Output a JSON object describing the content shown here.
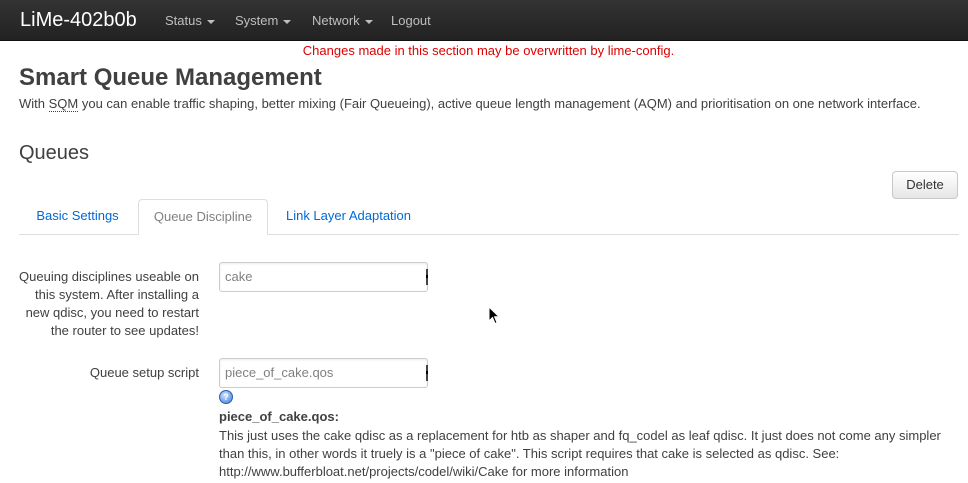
{
  "navbar": {
    "brand": "LiMe-402b0b",
    "items": [
      {
        "label": "Status",
        "dropdown": true
      },
      {
        "label": "System",
        "dropdown": true
      },
      {
        "label": "Network",
        "dropdown": true
      },
      {
        "label": "Logout",
        "dropdown": false
      }
    ]
  },
  "warning": "Changes made in this section may be overwritten by lime-config.",
  "page": {
    "title": "Smart Queue Management",
    "desc_prefix": "With ",
    "desc_abbr": "SQM",
    "desc_suffix": " you can enable traffic shaping, better mixing (Fair Queueing), active queue length management (AQM) and prioritisation on one network interface."
  },
  "section": {
    "title": "Queues",
    "delete_label": "Delete",
    "tabs": [
      {
        "label": "Basic Settings",
        "active": false
      },
      {
        "label": "Queue Discipline",
        "active": true
      },
      {
        "label": "Link Layer Adaptation",
        "active": false
      }
    ]
  },
  "fields": {
    "qdisc": {
      "label": "Queuing disciplines useable on this system. After installing a new qdisc, you need to restart the router to see updates!",
      "value": "cake"
    },
    "script": {
      "label": "Queue setup script",
      "value": "piece_of_cake.qos",
      "help_title": "piece_of_cake.qos:",
      "help_text": "This just uses the cake qdisc as a replacement for htb as shaper and fq_codel as leaf qdisc. It just does not come any simpler than this, in other words it truely is a \"piece of cake\". This script requires that cake is selected as qdisc. See: http://www.bufferbloat.net/projects/codel/wiki/Cake for more information"
    }
  },
  "colors": {
    "navbar_bg": "#222222",
    "warning": "#dd0000",
    "link": "#0069d6"
  }
}
